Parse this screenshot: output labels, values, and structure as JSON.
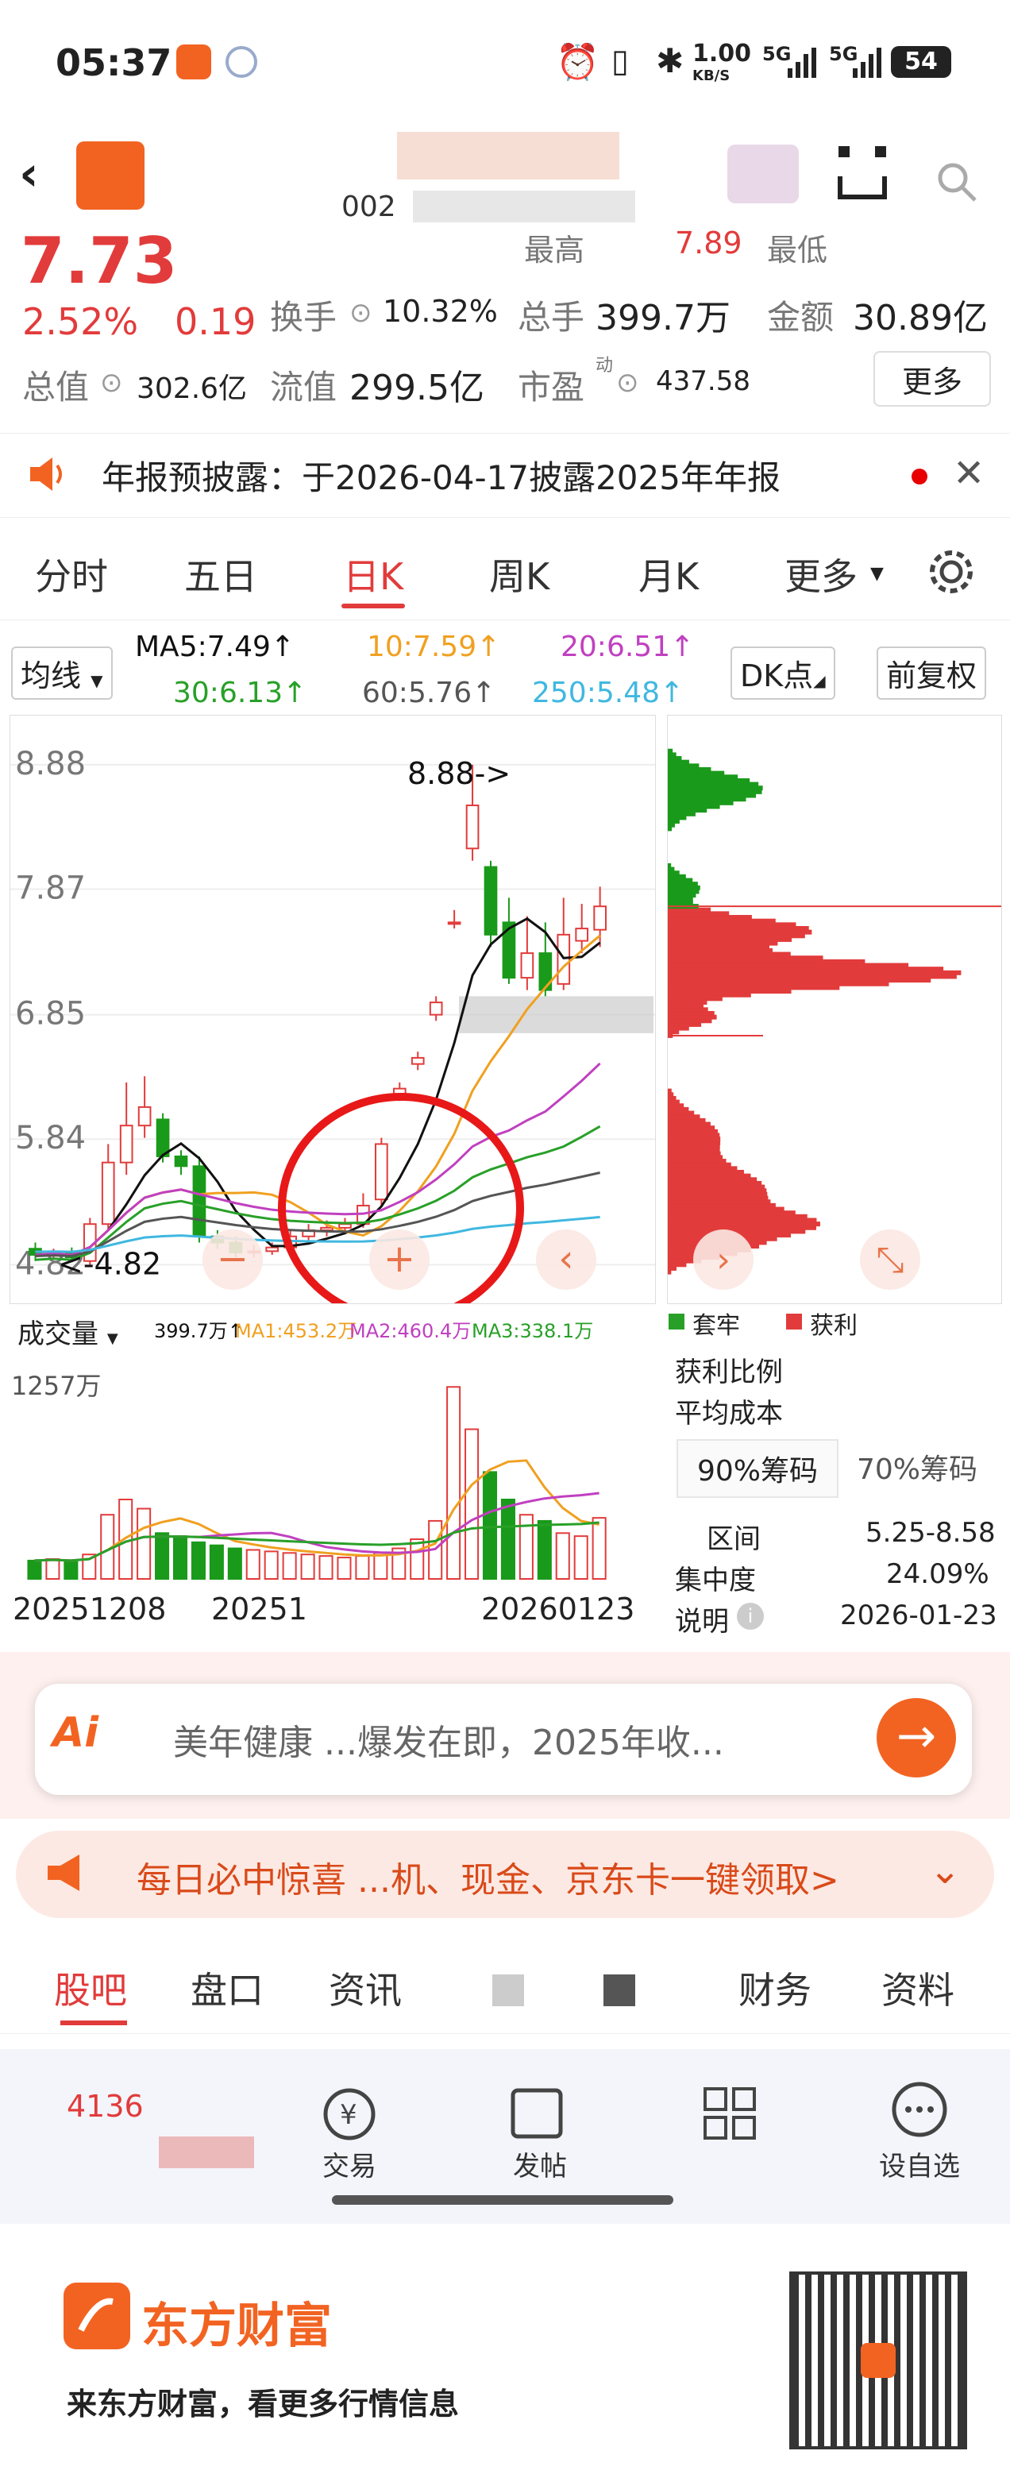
{
  "status": {
    "time": "05:37",
    "net_speed": "1.00",
    "net_unit": "KB/S",
    "signal1": "5G",
    "signal2": "5G",
    "battery": "54"
  },
  "nav": {
    "code_partial": "002"
  },
  "quote": {
    "price": "7.73",
    "change_pct": "2.52%",
    "change_abs": "0.19",
    "high_label": "最高",
    "high_value": "7.89",
    "low_label": "最低",
    "turnover_label": "换手",
    "turnover_value": "10.32%",
    "volume_label": "总手",
    "volume_value": "399.7万",
    "amount_label": "金额",
    "amount_value": "30.89亿",
    "total_mv_label": "总值",
    "total_mv_value": "302.6亿",
    "float_mv_label": "流值",
    "float_mv_value": "299.5亿",
    "pe_label": "市盈",
    "pe_sup": "动",
    "pe_value": "437.58",
    "more_button": "更多"
  },
  "notice": {
    "text": "年报预披露：于2026-04-17披露2025年年报"
  },
  "tabs": {
    "items": [
      "分时",
      "五日",
      "日K",
      "周K",
      "月K",
      "更多"
    ],
    "active": "日K"
  },
  "ma_bar": {
    "selector": "均线",
    "ma5": "MA5:7.49↑",
    "ma10": "10:7.59↑",
    "ma20": "20:6.51↑",
    "ma30": "30:6.13↑",
    "ma60": "60:5.76↑",
    "ma250": "250:5.48↑",
    "dk_button": "DK点",
    "adjust_button": "前复权"
  },
  "kline": {
    "y_labels": [
      "8.88",
      "7.87",
      "6.85",
      "5.84",
      "4.82"
    ],
    "max_marker": "8.88->",
    "min_marker": "<-4.82",
    "candles": [
      {
        "o": 4.95,
        "c": 4.9,
        "h": 5.0,
        "l": 4.85
      },
      {
        "o": 4.9,
        "c": 4.92,
        "h": 4.95,
        "l": 4.86
      },
      {
        "o": 4.92,
        "c": 4.88,
        "h": 4.96,
        "l": 4.84
      },
      {
        "o": 4.85,
        "c": 5.15,
        "h": 5.2,
        "l": 4.82
      },
      {
        "o": 5.15,
        "c": 5.65,
        "h": 5.8,
        "l": 5.1
      },
      {
        "o": 5.65,
        "c": 5.95,
        "h": 6.3,
        "l": 5.55
      },
      {
        "o": 5.95,
        "c": 6.1,
        "h": 6.35,
        "l": 5.85
      },
      {
        "o": 6.0,
        "c": 5.7,
        "h": 6.05,
        "l": 5.65
      },
      {
        "o": 5.7,
        "c": 5.62,
        "h": 5.75,
        "l": 5.55
      },
      {
        "o": 5.62,
        "c": 5.05,
        "h": 5.7,
        "l": 5.0
      },
      {
        "o": 5.05,
        "c": 5.0,
        "h": 5.1,
        "l": 4.95
      },
      {
        "o": 5.0,
        "c": 4.92,
        "h": 5.05,
        "l": 4.88
      },
      {
        "o": 4.92,
        "c": 4.93,
        "h": 4.98,
        "l": 4.88
      },
      {
        "o": 4.93,
        "c": 4.96,
        "h": 5.0,
        "l": 4.9
      },
      {
        "o": 4.96,
        "c": 5.05,
        "h": 5.1,
        "l": 4.94
      },
      {
        "o": 5.05,
        "c": 5.1,
        "h": 5.15,
        "l": 5.0
      },
      {
        "o": 5.1,
        "c": 5.12,
        "h": 5.18,
        "l": 5.05
      },
      {
        "o": 5.12,
        "c": 5.15,
        "h": 5.2,
        "l": 5.08
      },
      {
        "o": 5.15,
        "c": 5.3,
        "h": 5.4,
        "l": 5.12
      },
      {
        "o": 5.35,
        "c": 5.8,
        "h": 5.85,
        "l": 5.3
      },
      {
        "o": 6.2,
        "c": 6.25,
        "h": 6.3,
        "l": 6.15
      },
      {
        "o": 6.45,
        "c": 6.5,
        "h": 6.55,
        "l": 6.4
      },
      {
        "o": 6.85,
        "c": 6.95,
        "h": 7.0,
        "l": 6.8
      },
      {
        "o": 7.6,
        "c": 7.6,
        "h": 7.7,
        "l": 7.55
      },
      {
        "o": 8.2,
        "c": 8.55,
        "h": 8.88,
        "l": 8.1
      },
      {
        "o": 8.05,
        "c": 7.5,
        "h": 8.1,
        "l": 7.4
      },
      {
        "o": 7.6,
        "c": 7.15,
        "h": 7.8,
        "l": 7.1
      },
      {
        "o": 7.15,
        "c": 7.35,
        "h": 7.65,
        "l": 7.05
      },
      {
        "o": 7.35,
        "c": 7.05,
        "h": 7.6,
        "l": 7.0
      },
      {
        "o": 7.1,
        "c": 7.5,
        "h": 7.8,
        "l": 7.05
      },
      {
        "o": 7.45,
        "c": 7.55,
        "h": 7.75,
        "l": 7.35
      },
      {
        "o": 7.54,
        "c": 7.73,
        "h": 7.89,
        "l": 7.4
      }
    ]
  },
  "controls": {
    "minus": "−",
    "plus": "+",
    "back": "‹",
    "forward": "›"
  },
  "volume": {
    "selector": "成交量",
    "vol": "399.7万↑",
    "ma1": "MA1:453.2万",
    "ma2": "MA2:460.4万",
    "ma3": "MA3:338.1万",
    "top_label": "1257万",
    "date_start": "20251208",
    "date_mid": "20251",
    "date_end": "20260123",
    "bars": [
      120,
      130,
      110,
      160,
      420,
      520,
      460,
      300,
      280,
      240,
      220,
      200,
      190,
      180,
      170,
      160,
      150,
      140,
      150,
      170,
      200,
      260,
      380,
      1257,
      980,
      700,
      520,
      420,
      380,
      300,
      280,
      399.7
    ]
  },
  "chips": {
    "legend_trapped": "套牢",
    "legend_profit": "获利",
    "profit_ratio_label": "获利比例",
    "avg_cost_label": "平均成本",
    "chip90": "90%筹码",
    "chip70": "70%筹码",
    "range_label": "区间",
    "range_value": "5.25-8.58",
    "concentration_label": "集中度",
    "concentration_value": "24.09%",
    "note_label": "说明",
    "note_value": "2026-01-23"
  },
  "ai": {
    "logo": "Ai",
    "text": "美年健康   ...爆发在即，2025年收..."
  },
  "promo": {
    "text": "每日必中惊喜   ...机、现金、京东卡一键领取>"
  },
  "subtabs": {
    "items": [
      "股吧",
      "盘口",
      "资讯",
      "",
      "",
      "财务",
      "资料"
    ]
  },
  "bottom_bar": {
    "count": "4136",
    "items": [
      "",
      "交易",
      "发帖",
      "",
      "设自选"
    ]
  },
  "footer": {
    "brand": "东方财富",
    "slogan": "来东方财富，看更多行情信息"
  },
  "colors": {
    "up": "#e23b3b",
    "down": "#1a9a1a",
    "brand": "#f26322",
    "ma5": "#111111",
    "ma10": "#f0a020",
    "ma20": "#c040c0",
    "ma30": "#28a028",
    "ma60": "#555555",
    "ma250": "#40b8e0",
    "circle": "#e81818"
  }
}
